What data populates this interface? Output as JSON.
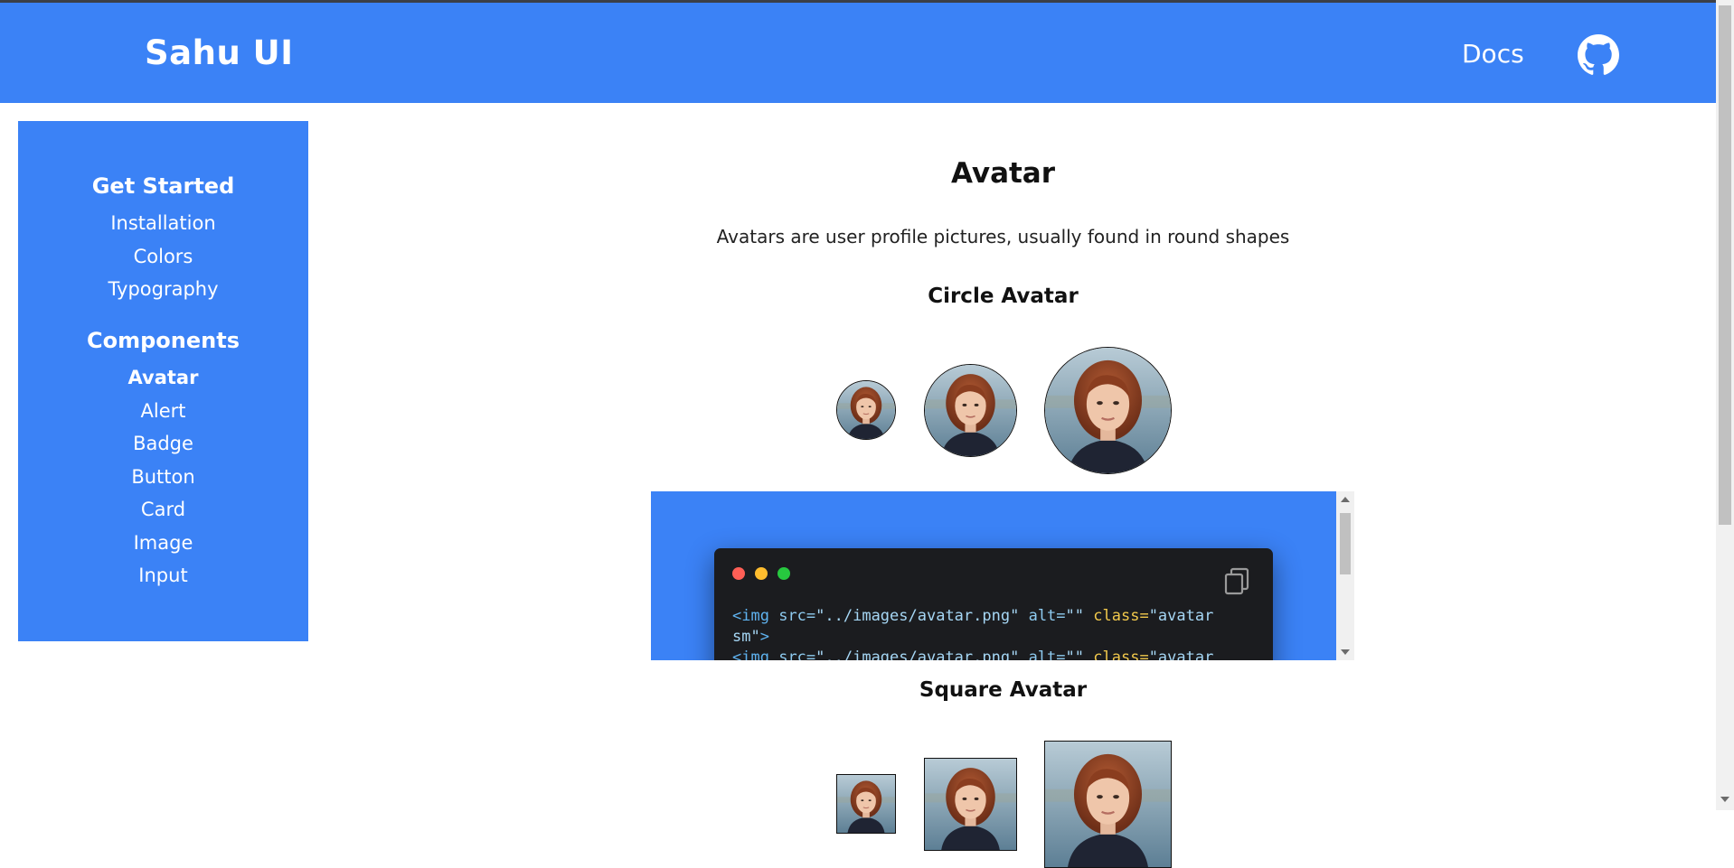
{
  "navbar": {
    "brand": "Sahu UI",
    "docs_label": "Docs",
    "github_icon": "github-icon"
  },
  "sidebar": {
    "get_started": {
      "heading": "Get Started",
      "items": [
        "Installation",
        "Colors",
        "Typography"
      ]
    },
    "components": {
      "heading": "Components",
      "items": [
        "Avatar",
        "Alert",
        "Badge",
        "Button",
        "Card",
        "Image",
        "Input"
      ],
      "active": "Avatar"
    }
  },
  "main": {
    "title": "Avatar",
    "description": "Avatars are user profile pictures, usually found in round shapes",
    "circle_section": {
      "title": "Circle Avatar"
    },
    "square_section": {
      "title": "Square Avatar"
    },
    "code": {
      "copy_icon": "copy-icon",
      "tag": "<img",
      "src_attr": "src=",
      "src_val": "\"../images/avatar.png\"",
      "alt_attr": "alt=",
      "alt_val": "\"\"",
      "class_attr": "class=",
      "class_val_line1": "\"avatar",
      "class_val_line2": "sm\"",
      "close": ">",
      "window_buttons": [
        "#ff5f56",
        "#ffbd2e",
        "#27c93f"
      ]
    }
  },
  "colors": {
    "accent": "#3b82f6",
    "code_bg": "#1b1c1f"
  }
}
